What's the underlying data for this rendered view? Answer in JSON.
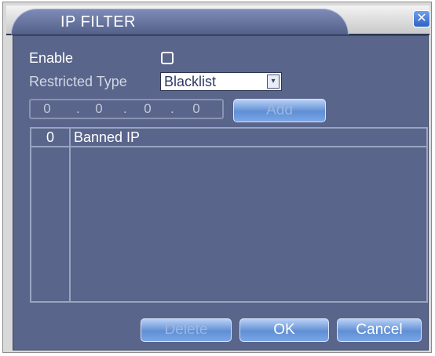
{
  "window": {
    "title": "IP FILTER",
    "close_glyph": "✕"
  },
  "form": {
    "enable_label": "Enable",
    "enable_checked": false,
    "restricted_type_label": "Restricted Type",
    "restricted_type_value": "Blacklist",
    "dropdown_glyph": "▾",
    "ip_octets": [
      "0",
      "0",
      "0",
      "0"
    ],
    "ip_separator": "."
  },
  "buttons": {
    "add": "Add",
    "delete": "Delete",
    "ok": "OK",
    "cancel": "Cancel"
  },
  "list": {
    "columns": [
      "0",
      "Banned IP"
    ],
    "rows": []
  },
  "colors": {
    "panel": "#59658b",
    "title_tab": "#6a78a4",
    "button": "#6f9ade",
    "close_button": "#3e73d6"
  },
  "icons": {
    "close": "close-icon",
    "dropdown": "chevron-down-icon"
  }
}
